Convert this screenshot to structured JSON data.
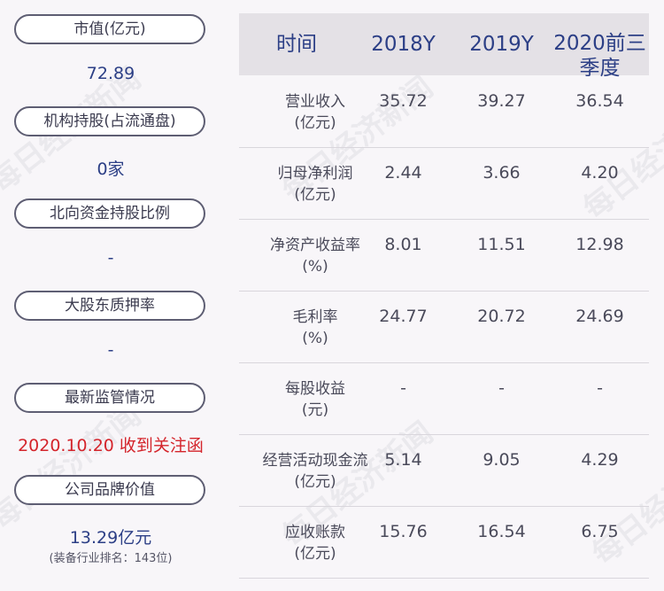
{
  "left": {
    "items": [
      {
        "label": "市值(亿元)",
        "value": "72.89"
      },
      {
        "label": "机构持股(占流通盘)",
        "value": "0家"
      },
      {
        "label": "北向资金持股比例",
        "value": "-"
      },
      {
        "label": "大股东质押率",
        "value": "-"
      },
      {
        "label": "最新监管情况",
        "value": "2020.10.20 收到关注函"
      },
      {
        "label": "公司品牌价值",
        "value": "13.29亿元",
        "note": "(装备行业排名：143位)"
      }
    ]
  },
  "table": {
    "headers": [
      "时间",
      "2018Y",
      "2019Y",
      "2020前三季度"
    ],
    "rows": [
      {
        "label_line1": "营业收入",
        "label_line2": "(亿元)",
        "values": [
          "35.72",
          "39.27",
          "36.54"
        ]
      },
      {
        "label_line1": "归母净利润",
        "label_line2": "(亿元)",
        "values": [
          "2.44",
          "3.66",
          "4.20"
        ]
      },
      {
        "label_line1": "净资产收益率",
        "label_line2": "(%)",
        "values": [
          "8.01",
          "11.51",
          "12.98"
        ]
      },
      {
        "label_line1": "毛利率",
        "label_line2": "(%)",
        "values": [
          "24.77",
          "20.72",
          "24.69"
        ]
      },
      {
        "label_line1": "每股收益",
        "label_line2": "(元)",
        "values": [
          "-",
          "-",
          "-"
        ]
      },
      {
        "label_line1": "经营活动现金流",
        "label_line2": "(亿元)",
        "values": [
          "5.14",
          "9.05",
          "4.29"
        ]
      },
      {
        "label_line1": "应收账款",
        "label_line2": "(亿元)",
        "values": [
          "15.76",
          "16.54",
          "6.75"
        ]
      }
    ]
  },
  "watermark": "每日经济新闻",
  "colors": {
    "accent": "#2c3f86",
    "alert": "#d4242b",
    "header_bg": "#e4e1e6"
  }
}
